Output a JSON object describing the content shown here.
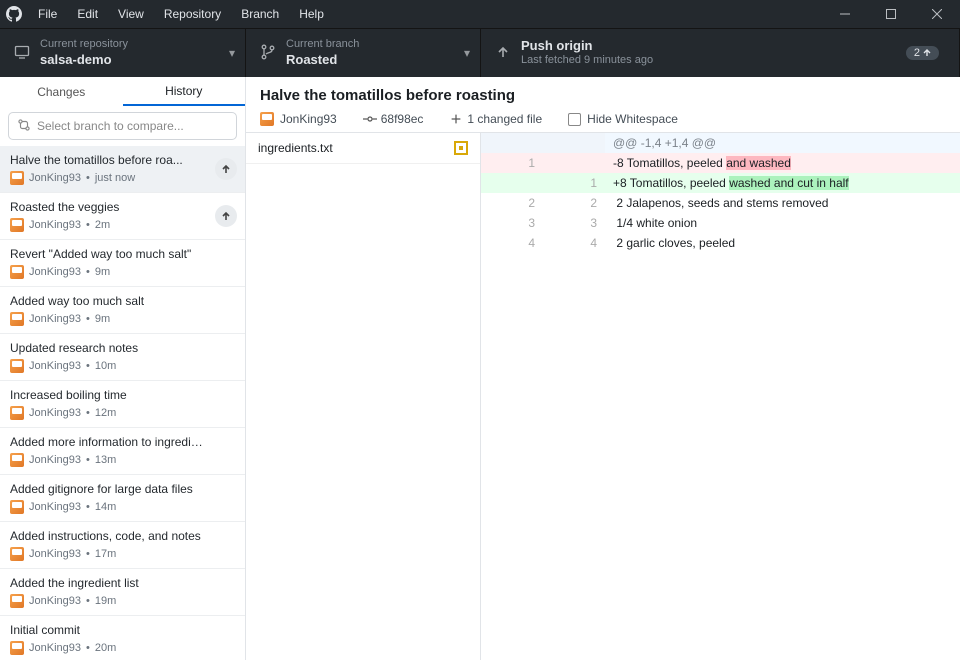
{
  "menu": {
    "items": [
      "File",
      "Edit",
      "View",
      "Repository",
      "Branch",
      "Help"
    ]
  },
  "toolbar": {
    "repo": {
      "sub": "Current repository",
      "name": "salsa-demo"
    },
    "branch": {
      "sub": "Current branch",
      "name": "Roasted"
    },
    "push": {
      "title": "Push origin",
      "sub": "Last fetched 9 minutes ago",
      "badge": "2"
    }
  },
  "tabs": {
    "changes": "Changes",
    "history": "History"
  },
  "compare_placeholder": "Select branch to compare...",
  "commits": [
    {
      "title": "Halve the tomatillos before roa...",
      "author": "JonKing93",
      "time": "just now",
      "push": true,
      "selected": true
    },
    {
      "title": "Roasted the veggies",
      "author": "JonKing93",
      "time": "2m",
      "push": true,
      "selected": false
    },
    {
      "title": "Revert \"Added way too much salt\"",
      "author": "JonKing93",
      "time": "9m",
      "push": false,
      "selected": false
    },
    {
      "title": "Added way too much salt",
      "author": "JonKing93",
      "time": "9m",
      "push": false,
      "selected": false
    },
    {
      "title": "Updated research notes",
      "author": "JonKing93",
      "time": "10m",
      "push": false,
      "selected": false
    },
    {
      "title": "Increased boiling time",
      "author": "JonKing93",
      "time": "12m",
      "push": false,
      "selected": false
    },
    {
      "title": "Added more information to ingredient...",
      "author": "JonKing93",
      "time": "13m",
      "push": false,
      "selected": false
    },
    {
      "title": "Added gitignore for large data files",
      "author": "JonKing93",
      "time": "14m",
      "push": false,
      "selected": false
    },
    {
      "title": "Added instructions, code, and notes",
      "author": "JonKing93",
      "time": "17m",
      "push": false,
      "selected": false
    },
    {
      "title": "Added the ingredient list",
      "author": "JonKing93",
      "time": "19m",
      "push": false,
      "selected": false
    },
    {
      "title": "Initial commit",
      "author": "JonKing93",
      "time": "20m",
      "push": false,
      "selected": false
    }
  ],
  "commit_detail": {
    "title": "Halve the tomatillos before roasting",
    "author": "JonKing93",
    "sha": "68f98ec",
    "files_label": "1 changed file",
    "hide_ws": "Hide Whitespace",
    "file": "ingredients.txt"
  },
  "diff": {
    "hunk": "@@ -1,4 +1,4 @@",
    "del": {
      "oldno": "1",
      "prefix": "-",
      "text": "8 Tomatillos, peeled ",
      "hl": "and washed"
    },
    "add": {
      "newno": "1",
      "prefix": "+",
      "text": "8 Tomatillos, peeled ",
      "hl": "washed and cut in half"
    },
    "ctx": [
      {
        "oldno": "2",
        "newno": "2",
        "text": " 2 Jalapenos, seeds and stems removed"
      },
      {
        "oldno": "3",
        "newno": "3",
        "text": " 1/4 white onion"
      },
      {
        "oldno": "4",
        "newno": "4",
        "text": " 2 garlic cloves, peeled"
      }
    ]
  }
}
